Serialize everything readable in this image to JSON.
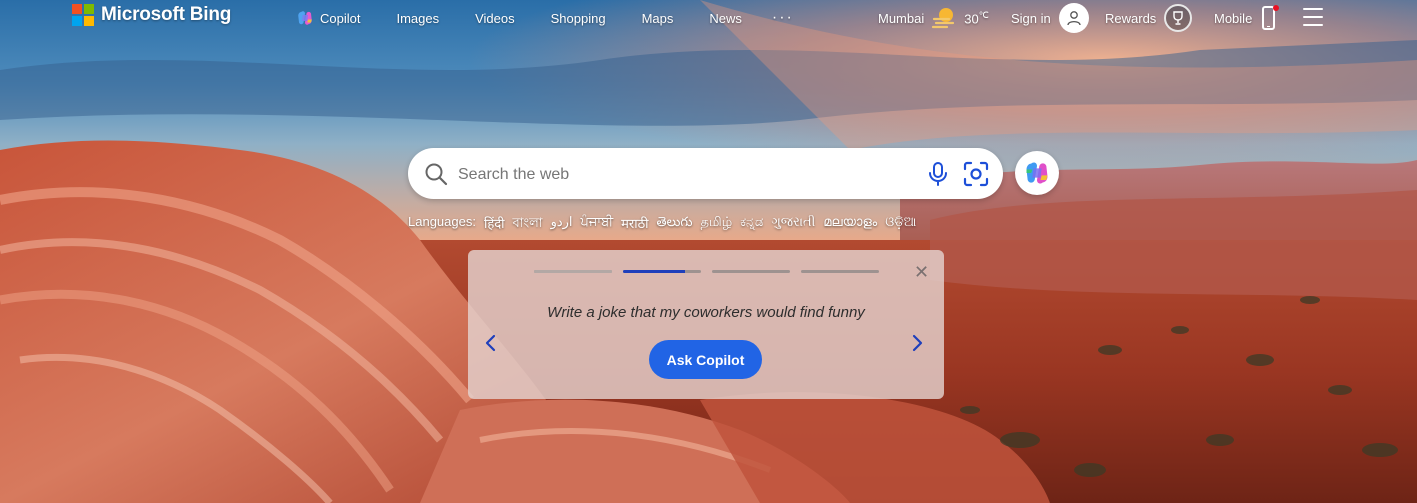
{
  "app": {
    "title": "Microsoft Bing"
  },
  "colors": {
    "ms_red": "#f25022",
    "ms_green": "#7fba00",
    "ms_blue": "#00a4ef",
    "ms_yellow": "#ffb900",
    "accent_blue": "#2164e5",
    "progress_active": "#1f3fbb"
  },
  "header": {
    "logo_text": "Microsoft Bing",
    "nav": [
      {
        "label": "Copilot",
        "icon": "copilot-icon"
      },
      {
        "label": "Images"
      },
      {
        "label": "Videos"
      },
      {
        "label": "Shopping"
      },
      {
        "label": "Maps"
      },
      {
        "label": "News"
      }
    ],
    "more_label": "···",
    "location": "Mumbai",
    "weather_icon": "partly-sunny-icon",
    "temperature": "30",
    "temperature_unit": "℃",
    "signin_label": "Sign in",
    "avatar_icon": "person-icon",
    "rewards_label": "Rewards",
    "rewards_icon": "trophy-icon",
    "mobile_label": "Mobile",
    "mobile_icon": "phone-icon",
    "menu_icon": "hamburger-menu-icon"
  },
  "search": {
    "placeholder": "Search the web",
    "value": "",
    "search_icon": "search-icon",
    "mic_icon": "microphone-icon",
    "visual_search_icon": "visual-search-icon",
    "copilot_icon": "copilot-icon"
  },
  "languages": {
    "label": "Languages:",
    "items": [
      "हिंदी",
      "বাংলা",
      "اردو",
      "ਪੰਜਾਬੀ",
      "मराठी",
      "తెలుగు",
      "தமிழ்",
      "ಕನ್ನಡ",
      "ગુજરાતી",
      "മലയാളം",
      "ଓଡ଼ିଆ"
    ]
  },
  "card": {
    "progress": [
      1,
      0.8,
      0,
      0
    ],
    "prompt": "Write a joke that my coworkers would find funny",
    "button_label": "Ask Copilot",
    "close_icon": "close-icon",
    "prev_icon": "chevron-left-icon",
    "next_icon": "chevron-right-icon"
  }
}
